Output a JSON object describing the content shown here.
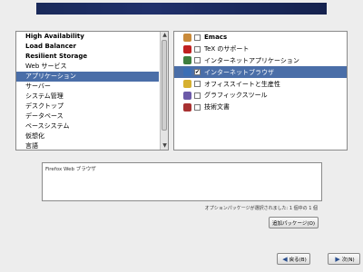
{
  "categories": [
    {
      "label": "High Availability",
      "bold": true
    },
    {
      "label": "Load Balancer",
      "bold": true
    },
    {
      "label": "Resilient Storage",
      "bold": true
    },
    {
      "label": "Web サービス",
      "bold": false
    },
    {
      "label": "アプリケーション",
      "bold": false,
      "selected": true
    },
    {
      "label": "サーバー",
      "bold": false
    },
    {
      "label": "システム管理",
      "bold": false
    },
    {
      "label": "デスクトップ",
      "bold": false
    },
    {
      "label": "データベース",
      "bold": false
    },
    {
      "label": "ベースシステム",
      "bold": false
    },
    {
      "label": "仮想化",
      "bold": false
    },
    {
      "label": "言語",
      "bold": false
    }
  ],
  "packages": [
    {
      "label": "Emacs",
      "icon": "emacs-icon",
      "color": "#c98a3a",
      "checked": false,
      "bold": true
    },
    {
      "label": "TeX のサポート",
      "icon": "tex-icon",
      "color": "#c02020",
      "checked": false,
      "bold": false
    },
    {
      "label": "インターネットアプリケーション",
      "icon": "globe-icon",
      "color": "#3f7f3f",
      "checked": false,
      "bold": false
    },
    {
      "label": "インターネットブラウザ",
      "icon": "browser-icon",
      "color": "#3b6fb5",
      "checked": true,
      "bold": false,
      "selected": true
    },
    {
      "label": "オフィススイートと生産性",
      "icon": "office-icon",
      "color": "#d6b030",
      "checked": false,
      "bold": false
    },
    {
      "label": "グラフィックスツール",
      "icon": "graphics-icon",
      "color": "#6c5aa8",
      "checked": false,
      "bold": false
    },
    {
      "label": "技術文書",
      "icon": "book-icon",
      "color": "#a83232",
      "checked": false,
      "bold": false
    }
  ],
  "description": "Firefox Web ブラウザ",
  "status": "オプションパッケージが選択されました: 1 個中の 1 個",
  "buttons": {
    "optional": "追加パッケージ(O)",
    "back": "戻る(B)",
    "next": "次(N)"
  }
}
